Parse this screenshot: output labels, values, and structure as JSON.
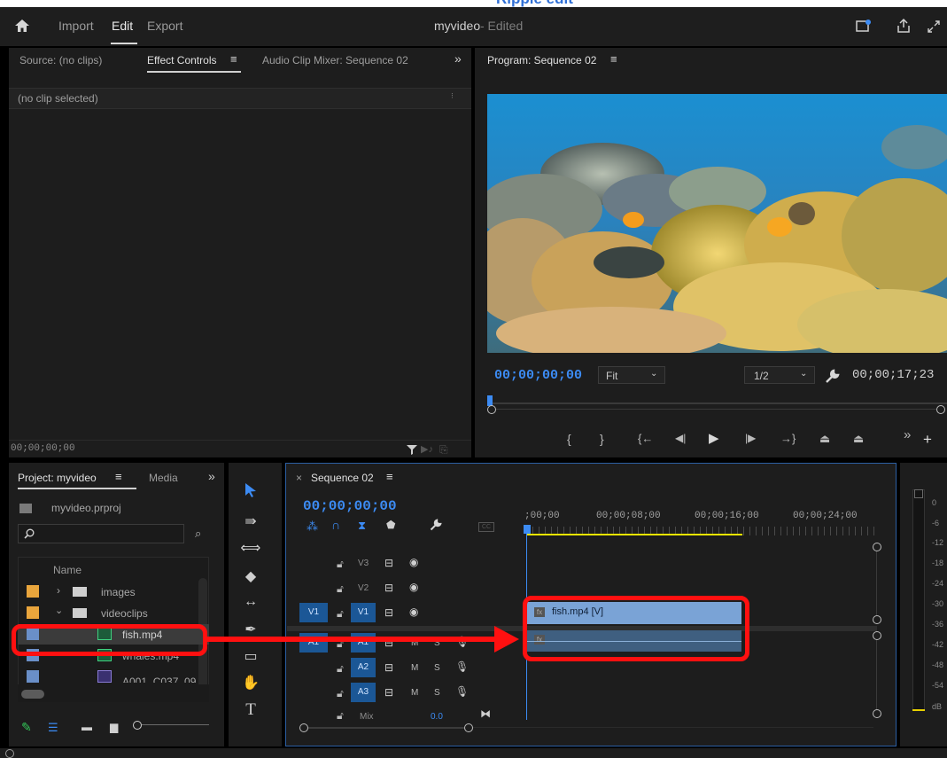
{
  "caption": {
    "text": "Ripple edit"
  },
  "topbar": {
    "home_icon": "home-icon",
    "import": "Import",
    "edit": "Edit",
    "export": "Export",
    "project_name": "myvideo",
    "edited": " - Edited"
  },
  "source_panel": {
    "tab_source": "Source: (no clips)",
    "tab_effect_controls": "Effect Controls",
    "tab_audio_mixer": "Audio Clip Mixer: Sequence 02",
    "no_clip": "(no clip selected)",
    "timecode": "00;00;00;00"
  },
  "program": {
    "title": "Program: Sequence 02",
    "timecode": "00;00;00;00",
    "fit": "Fit",
    "resolution": "1/2",
    "duration": "00;00;17;23"
  },
  "project": {
    "tab_project": "Project: myvideo",
    "tab_media": "Media",
    "file": "myvideo.prproj",
    "col_name": "Name",
    "items": [
      {
        "name": "images",
        "color": "#e9a53c"
      },
      {
        "name": "videoclips",
        "color": "#e9a53c"
      },
      {
        "name": "fish.mp4",
        "color": "#6a8fc8"
      },
      {
        "name": "whales.mp4",
        "color": "#6a8fc8"
      },
      {
        "name": "A001_C037_09",
        "color": "#6a8fc8"
      }
    ]
  },
  "timeline": {
    "close": "×",
    "title": "Sequence 02",
    "timecode": "00;00;00;00",
    "ruler": [
      ";00;00",
      "00;00;08;00",
      "00;00;16;00",
      "00;00;24;00"
    ],
    "tracks": {
      "v3": "V3",
      "v2": "V2",
      "v1": "V1",
      "a1": "A1",
      "a2": "A2",
      "a3": "A3",
      "mix": "Mix",
      "mix_value": "0.0",
      "m": "M",
      "s": "S"
    },
    "src_v1": "V1",
    "src_a1": "A1",
    "clip_video": "fish.mp4 [V]",
    "fx": "fx"
  },
  "meter": {
    "labels": [
      "0",
      "-6",
      "-12",
      "-18",
      "-24",
      "-30",
      "-36",
      "-42",
      "-48",
      "-54",
      "dB"
    ]
  },
  "colors": {
    "accent": "#3c8bf3",
    "highlight": "#ff1010",
    "clip": "#7aa3d6",
    "folder": "#e9a53c"
  }
}
